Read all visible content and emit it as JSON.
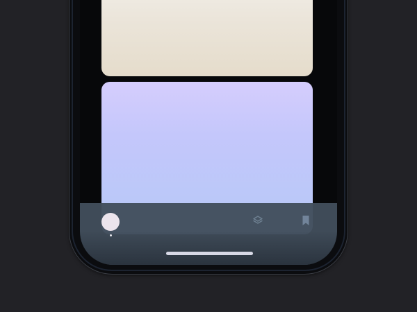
{
  "screen": {
    "cards": [
      {
        "id": "top-card",
        "gradient": [
          "#f2f0ea",
          "#e5dccb"
        ]
      },
      {
        "id": "bottom-card",
        "gradient": [
          "#d5cdfd",
          "#b6c8f7"
        ]
      }
    ]
  },
  "tab_bar": {
    "items": [
      {
        "icon": "avatar-icon",
        "active": true
      },
      {
        "icon": "layers-icon",
        "active": false
      },
      {
        "icon": "bookmark-icon",
        "active": false
      }
    ]
  },
  "colors": {
    "background": "#222226",
    "tab_bar": "#424e5c",
    "home_indicator": "#d8d9e6"
  }
}
